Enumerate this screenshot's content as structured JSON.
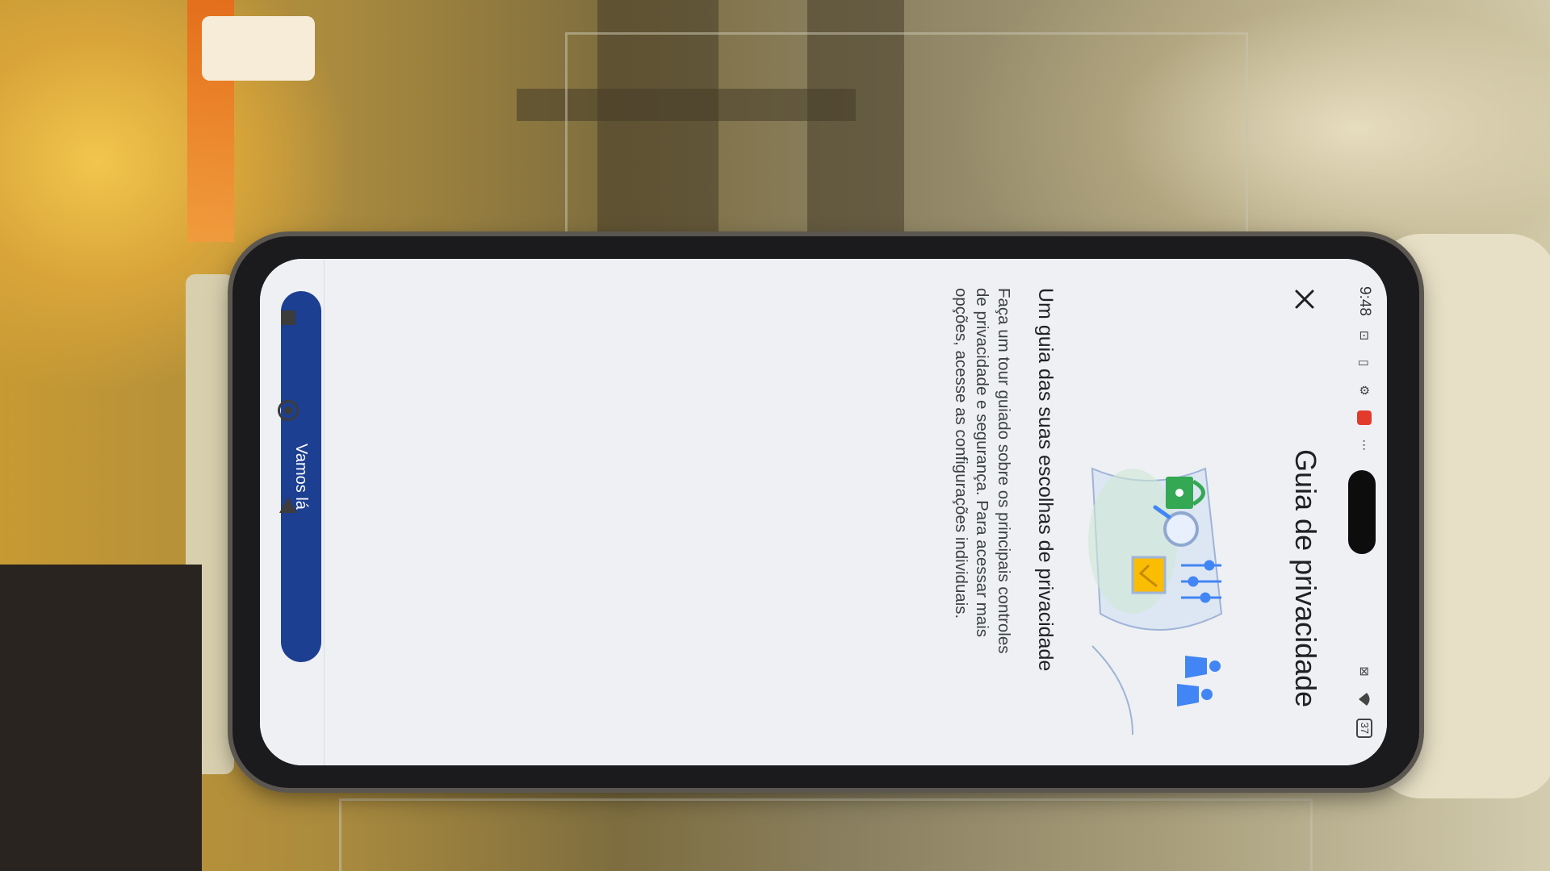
{
  "status_bar": {
    "time": "9:48",
    "battery": "37",
    "icons": [
      "nfc-icon",
      "sim-icon",
      "settings-gear-icon",
      "notification-icon",
      "more-icon",
      "no-sim-icon",
      "wifi-icon",
      "battery-icon"
    ]
  },
  "app_bar": {
    "title": "Guia de privacidade",
    "close_icon": "close-icon"
  },
  "content": {
    "headline": "Um guia das suas escolhas de privacidade",
    "body": "Faça um tour guiado sobre os principais controles de privacidade e segurança. Para acessar mais opções, acesse as configurações individuais."
  },
  "cta": {
    "label": "Vamos lá"
  },
  "nav": {
    "icons": [
      "recents-square-icon",
      "home-circle-icon",
      "back-triangle-icon"
    ]
  },
  "colors": {
    "primary_button": "#1d3f92",
    "screen_bg": "#eef0f4",
    "lock_green": "#34a853",
    "card_yellow": "#fbbc04",
    "accent_blue": "#4285f4"
  }
}
